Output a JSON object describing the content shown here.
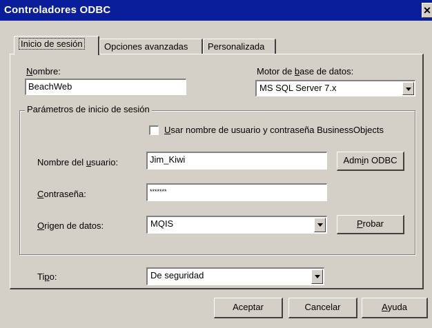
{
  "window": {
    "title": "Controladores ODBC",
    "close_glyph": "✕"
  },
  "tabs": [
    {
      "label": "Inicio de sesión",
      "active": true
    },
    {
      "label": "Opciones avanzadas",
      "active": false
    },
    {
      "label": "Personalizada",
      "active": false
    }
  ],
  "form": {
    "name_label_u": "N",
    "name_label_rest": "ombre:",
    "name_value": "BeachWeb",
    "engine_label_pre": "Motor de ",
    "engine_label_u": "b",
    "engine_label_rest": "ase de datos:",
    "engine_value": "MS SQL Server 7.x",
    "group_title": "Parámetros de inicio de sesión",
    "checkbox_label_pre": "U",
    "checkbox_label_rest": "sar nombre de usuario y contraseña BusinessObjects",
    "checkbox_checked": false,
    "user_label_pre": "Nombre del ",
    "user_label_u": "u",
    "user_label_rest": "suario:",
    "user_value": "Jim_Kiwi",
    "admin_button_pre": "Adm",
    "admin_button_u": "i",
    "admin_button_rest": "n ODBC",
    "password_label_u": "C",
    "password_label_rest": "ontraseña:",
    "password_value": "*******",
    "source_label_u": "O",
    "source_label_rest": "rigen de datos:",
    "source_value": "MQIS",
    "test_button_u": "P",
    "test_button_rest": "robar",
    "type_label_pre": "Ti",
    "type_label_u": "p",
    "type_label_rest": "o:",
    "type_value": "De seguridad"
  },
  "footer": {
    "accept_label": "Aceptar",
    "cancel_label": "Cancelar",
    "help_u": "A",
    "help_rest": "yuda"
  }
}
